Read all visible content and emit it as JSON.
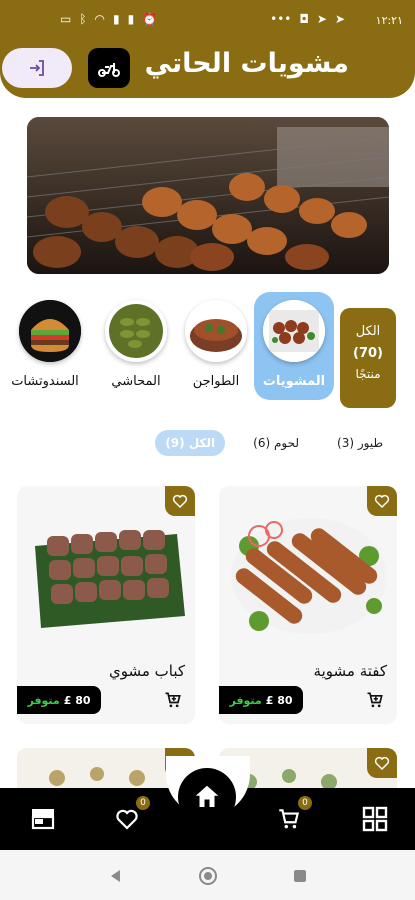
{
  "status": {
    "time": "١٢:٢١",
    "icons": [
      "battery-icon",
      "bluetooth-icon",
      "wifi-icon",
      "signal-icon",
      "signal-icon",
      "alarm-icon",
      "more-dots-icon",
      "send-icon",
      "camera-icon"
    ]
  },
  "header": {
    "title": "مشويات الحاتي",
    "scooter_icon": "scooter-icon",
    "login_icon": "login-icon"
  },
  "categories": {
    "all": {
      "label": "الكل",
      "count": "(70)",
      "unit": "منتجًا"
    },
    "items": [
      {
        "label": "المشويات",
        "active": true
      },
      {
        "label": "الطواجن",
        "active": false
      },
      {
        "label": "المحاشي",
        "active": false
      },
      {
        "label": "السندوتشات",
        "active": false
      }
    ]
  },
  "filters": [
    {
      "label": "الكل (9)",
      "active": true
    },
    {
      "label": "لحوم (6)",
      "active": false
    },
    {
      "label": "طيور (3)",
      "active": false
    }
  ],
  "products": [
    {
      "name": "كفتة مشوية",
      "price": "80 £",
      "availability": "متوفر"
    },
    {
      "name": "كباب مشوي",
      "price": "80 £",
      "availability": "متوفر"
    }
  ],
  "bottom_nav": {
    "cart_badge": "0",
    "fav_badge": "0"
  },
  "colors": {
    "brand": "#8a6d12",
    "active_category": "#8ec4f1",
    "available": "#37d343"
  }
}
